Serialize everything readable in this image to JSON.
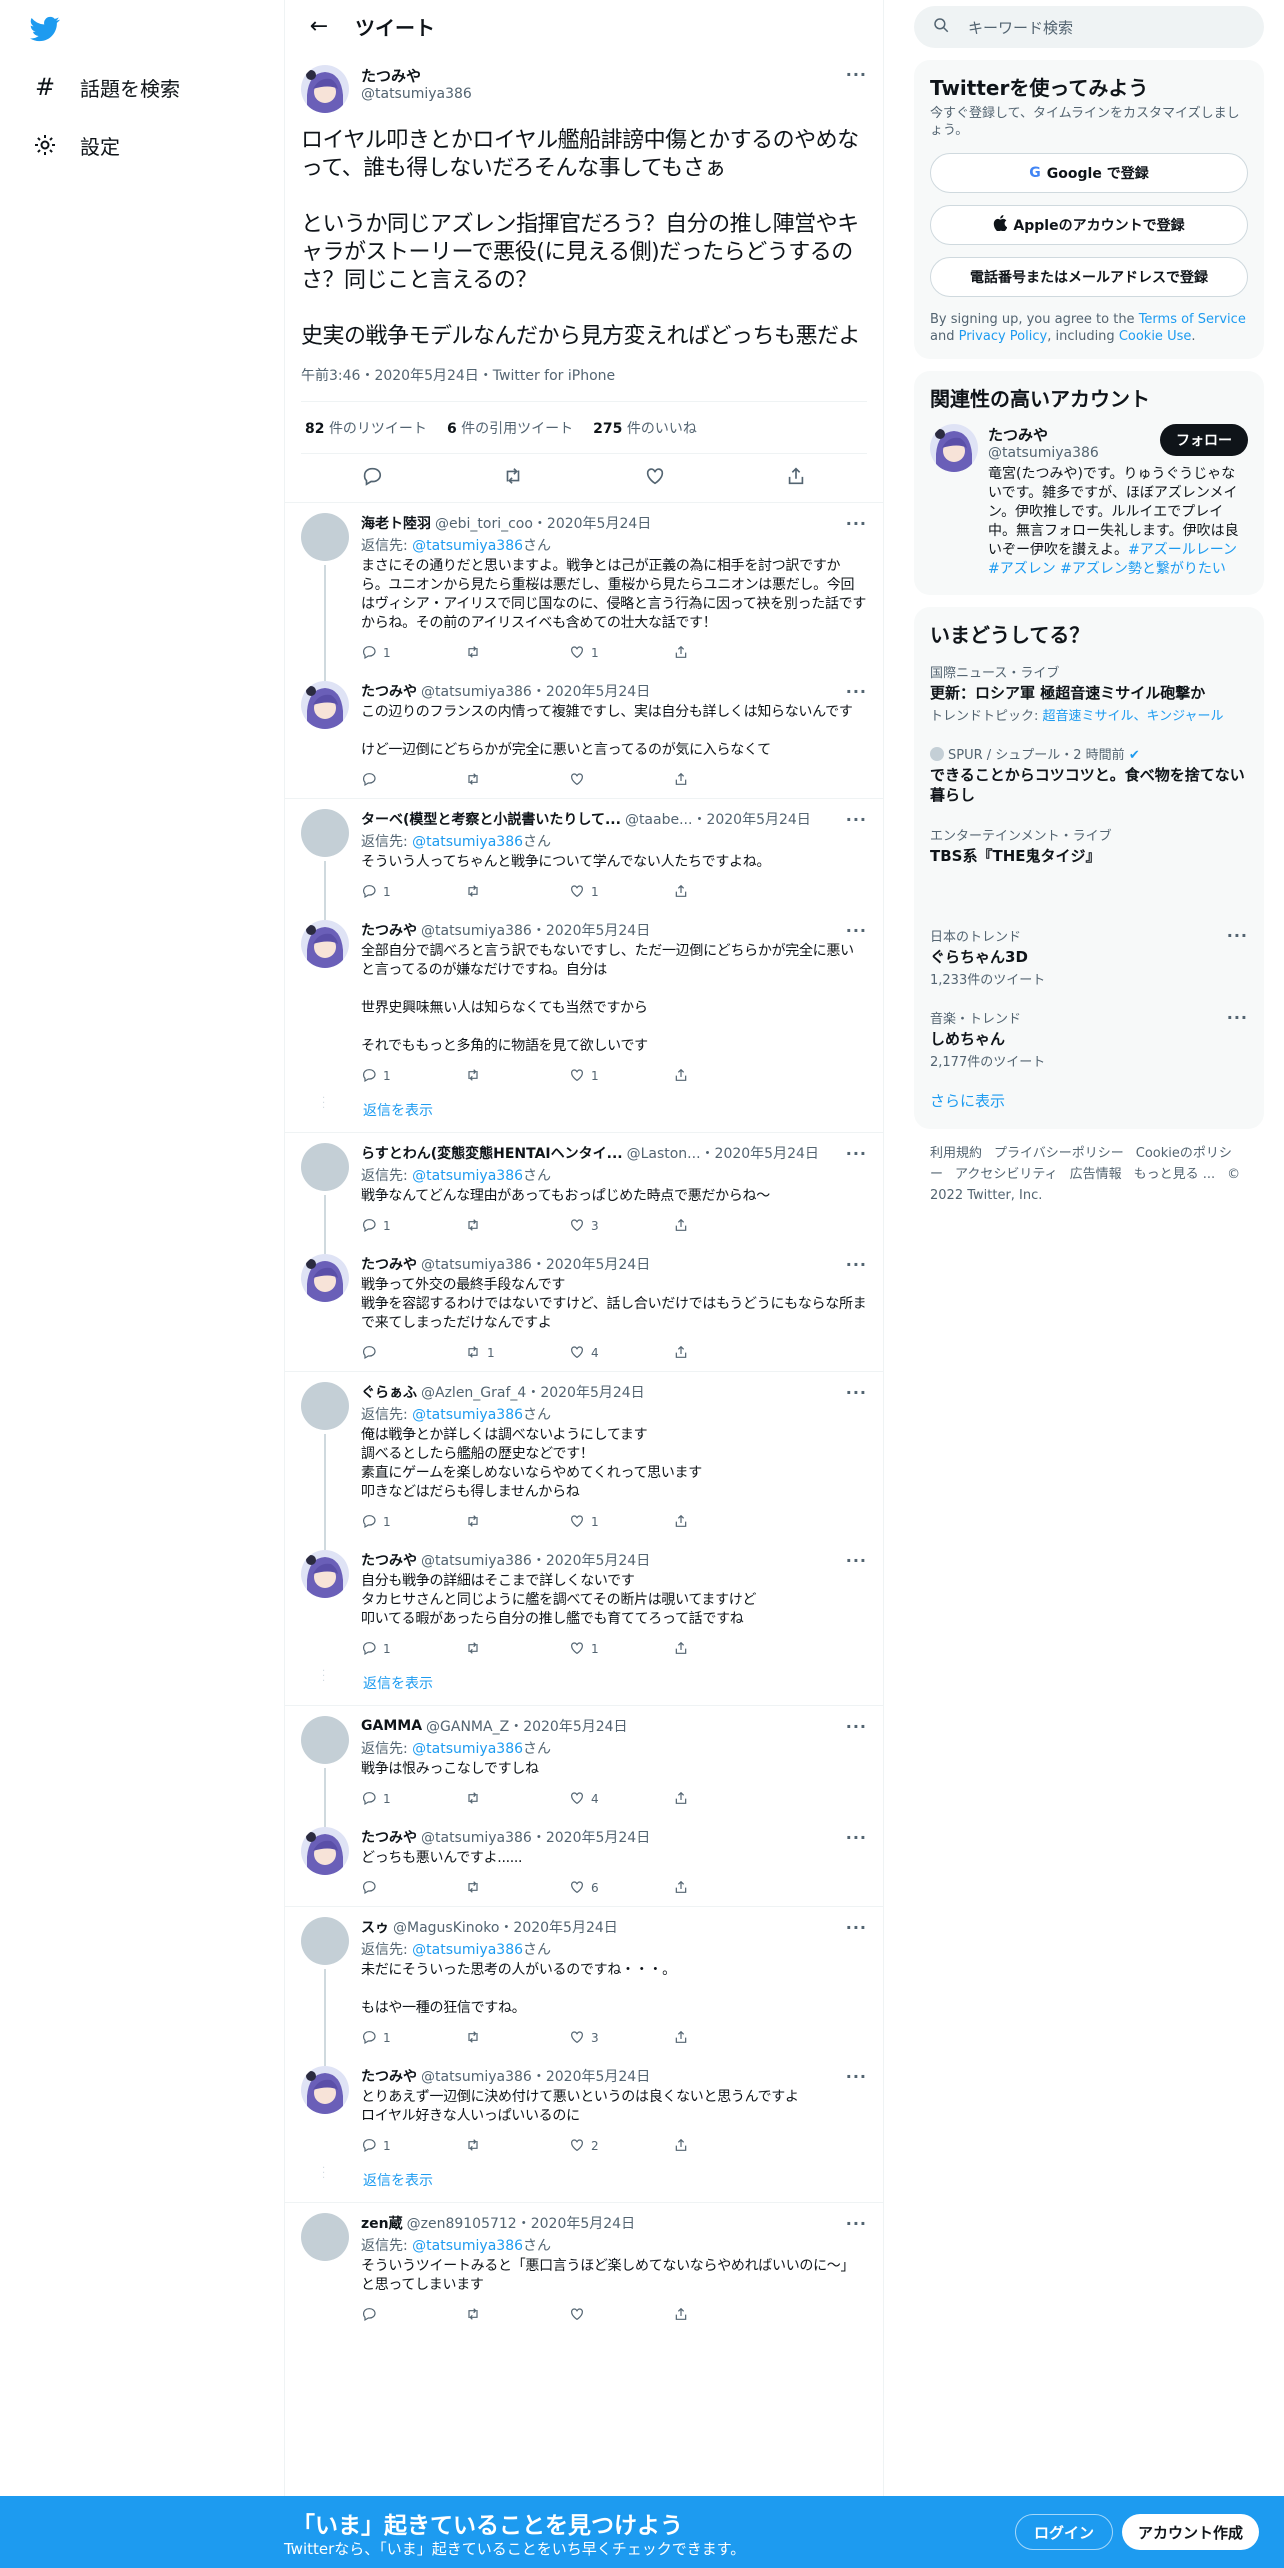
{
  "nav": {
    "items": [
      {
        "label": "話題を検索",
        "icon": "hashtag-icon"
      },
      {
        "label": "設定",
        "icon": "gear-icon"
      }
    ]
  },
  "header": {
    "title": "ツイート"
  },
  "focal": {
    "name": "たつみや",
    "handle": "@tatsumiya386",
    "text": "ロイヤル叩きとかロイヤル艦船誹謗中傷とかするのやめなって、誰も得しないだろそんな事してもさぁ\n\nというか同じアズレン指揮官だろう？自分の推し陣営やキャラがストーリーで悪役(に見える側)だったらどうするのさ？同じこと言えるの？\n\n史実の戦争モデルなんだから見方変えればどっちも悪だよ",
    "meta": "午前3:46・2020年5月24日・Twitter for iPhone",
    "retweets": "82",
    "retweets_label": "件のリツイート",
    "quotes": "6",
    "quotes_label": "件の引用ツイート",
    "likes": "275",
    "likes_label": "件のいいね"
  },
  "replies": [
    {
      "name": "海老ト陸羽",
      "handle": "@ebi_tori_coo",
      "date": "2020年5月24日",
      "reply_to": "@tatsumiya386",
      "text": "まさにその通りだと思いますよ。戦争とは己が正義の為に相手を討つ訳ですから。ユニオンから見たら重桜は悪だし、重桜から見たらユニオンは悪だし。今回はヴィシア・アイリスで同じ国なのに、侵略と言う行為に因って袂を別った話ですからね。その前のアイリスイベも含めての壮大な話です！",
      "replies": "1",
      "rts": "",
      "likes": "1",
      "avatar": "grey"
    },
    {
      "name": "たつみや",
      "handle": "@tatsumiya386",
      "date": "2020年5月24日",
      "reply_to": "",
      "text": "この辺りのフランスの内情って複雑ですし、実は自分も詳しくは知らないんです\n\nけど一辺倒にどちらかが完全に悪いと言ってるのが気に入らなくて",
      "replies": "",
      "rts": "",
      "likes": "",
      "avatar": "anime"
    },
    {
      "name": "ターベ(模型と考察と小説書いたりして...",
      "handle": "@taabe...",
      "date": "2020年5月24日",
      "reply_to": "@tatsumiya386",
      "text": "そういう人ってちゃんと戦争について学んでない人たちですよね。",
      "replies": "1",
      "rts": "",
      "likes": "1",
      "avatar": "grey"
    },
    {
      "name": "たつみや",
      "handle": "@tatsumiya386",
      "date": "2020年5月24日",
      "reply_to": "",
      "text": "全部自分で調べろと言う訳でもないですし、ただ一辺倒にどちらかが完全に悪いと言ってるのが嫌なだけですね。自分は\n\n世界史興味無い人は知らなくても当然ですから\n\nそれでももっと多角的に物語を見て欲しいです",
      "replies": "1",
      "rts": "",
      "likes": "1",
      "avatar": "anime"
    },
    {
      "name": "らすとわん(変態変態HENTAIヘンタイ...",
      "handle": "@Laston...",
      "date": "2020年5月24日",
      "reply_to": "@tatsumiya386",
      "text": "戦争なんてどんな理由があってもおっぱじめた時点で悪だからね〜",
      "replies": "1",
      "rts": "",
      "likes": "3",
      "avatar": "grey"
    },
    {
      "name": "たつみや",
      "handle": "@tatsumiya386",
      "date": "2020年5月24日",
      "reply_to": "",
      "text": "戦争って外交の最終手段なんです\n戦争を容認するわけではないですけど、話し合いだけではもうどうにもならな所まで来てしまっただけなんですよ",
      "replies": "",
      "rts": "1",
      "likes": "4",
      "avatar": "anime"
    },
    {
      "name": "ぐらぁふ",
      "handle": "@Azlen_Graf_4",
      "date": "2020年5月24日",
      "reply_to": "@tatsumiya386",
      "text": "俺は戦争とか詳しくは調べないようにしてます\n調べるとしたら艦船の歴史などです！\n素直にゲームを楽しめないならやめてくれって思います\n叩きなどはだらも得しませんからね",
      "replies": "1",
      "rts": "",
      "likes": "1",
      "avatar": "grey"
    },
    {
      "name": "たつみや",
      "handle": "@tatsumiya386",
      "date": "2020年5月24日",
      "reply_to": "",
      "text": "自分も戦争の詳細はそこまで詳しくないです\nタカヒサさんと同じように艦を調べてその断片は覗いてますけど\n叩いてる暇があったら自分の推し艦でも育ててろって話ですね",
      "replies": "1",
      "rts": "",
      "likes": "1",
      "avatar": "anime"
    },
    {
      "name": "GAMMA",
      "handle": "@GANMA_Z",
      "date": "2020年5月24日",
      "reply_to": "@tatsumiya386",
      "text": "戦争は恨みっこなしですしね",
      "replies": "1",
      "rts": "",
      "likes": "4",
      "avatar": "grey"
    },
    {
      "name": "たつみや",
      "handle": "@tatsumiya386",
      "date": "2020年5月24日",
      "reply_to": "",
      "text": "どっちも悪いんですよ......",
      "replies": "",
      "rts": "",
      "likes": "6",
      "avatar": "anime"
    },
    {
      "name": "スゥ",
      "handle": "@MagusKinoko",
      "date": "2020年5月24日",
      "reply_to": "@tatsumiya386",
      "text": "未だにそういった思考の人がいるのですね・・・。\n\nもはや一種の狂信ですね。",
      "replies": "1",
      "rts": "",
      "likes": "3",
      "avatar": "grey"
    },
    {
      "name": "たつみや",
      "handle": "@tatsumiya386",
      "date": "2020年5月24日",
      "reply_to": "",
      "text": "とりあえず一辺倒に決め付けて悪いというのは良くないと思うんですよ\nロイヤル好きな人いっぱいいるのに",
      "replies": "1",
      "rts": "",
      "likes": "2",
      "avatar": "anime"
    },
    {
      "name": "zen蔵",
      "handle": "@zen89105712",
      "date": "2020年5月24日",
      "reply_to": "@tatsumiya386",
      "text": "そういうツイートみると「悪口言うほど楽しめてないならやめればいいのに〜」と思ってしまいます",
      "replies": "",
      "rts": "",
      "likes": "",
      "avatar": "grey"
    }
  ],
  "reply_to_label": "返信先: ",
  "reply_to_suffix": "さん",
  "show_replies_label": "返信を表示",
  "right": {
    "search_placeholder": "キーワード検索",
    "signup": {
      "title": "Twitterを使ってみよう",
      "subtitle": "今すぐ登録して、タイムラインをカスタマイズしましょう。",
      "google": "Google で登録",
      "apple": "Appleのアカウントで登録",
      "phone": "電話番号またはメールアドレスで登録",
      "legal_1": "By signing up, you agree to the ",
      "tos": "Terms of Service",
      "legal_2": " and ",
      "privacy": "Privacy Policy",
      "legal_3": ", including ",
      "cookie": "Cookie Use",
      "legal_4": "."
    },
    "related": {
      "title": "関連性の高いアカウント",
      "name": "たつみや",
      "handle": "@tatsumiya386",
      "follow": "フォロー",
      "bio": "竜宮(たつみや)です。りゅうぐうじゃないです。雑多ですが、ほぼアズレンメイン。伊吹推しです。ルルイエでプレイ中。無言フォロー失礼します。伊吹は良いぞー伊吹を讃えよ。",
      "tags": "#アズールレーン #アズレン #アズレン勢と繋がりたい"
    },
    "trends": {
      "title": "いまどうしてる？",
      "items": [
        {
          "cat": "国際ニュース・ライブ",
          "title": "更新：ロシア軍 極超音速ミサイル砲撃か",
          "extra_label": "トレンドトピック: ",
          "extra": "超音速ミサイル、キンジャール",
          "count": ""
        },
        {
          "cat": "SPUR / シュプール・2 時間前",
          "title": "できることからコツコツと。食べ物を捨てない暮らし",
          "extra_label": "",
          "extra": "",
          "count": ""
        },
        {
          "cat": "エンターテインメント・ライブ",
          "title": "TBS系『THE鬼タイジ』",
          "extra_label": "",
          "extra": "",
          "count": ""
        },
        {
          "cat": "日本のトレンド",
          "title": "ぐらちゃん3D",
          "extra_label": "",
          "extra": "",
          "count": "1,233件のツイート"
        },
        {
          "cat": "音楽・トレンド",
          "title": "しめちゃん",
          "extra_label": "",
          "extra": "",
          "count": "2,177件のツイート"
        }
      ],
      "more": "さらに表示"
    },
    "footer": [
      "利用規約",
      "プライバシーポリシー",
      "Cookieのポリシー",
      "アクセシビリティ",
      "広告情報",
      "もっと見る ...",
      "© 2022 Twitter, Inc."
    ]
  },
  "bottom": {
    "headline": "「いま」起きていることを見つけよう",
    "sub": "Twitterなら、「いま」起きていることをいち早くチェックできます。",
    "login": "ログイン",
    "signup": "アカウント作成"
  },
  "colors": {
    "accent": "#1d9bf0",
    "text": "#0f1419",
    "muted": "#536471"
  }
}
